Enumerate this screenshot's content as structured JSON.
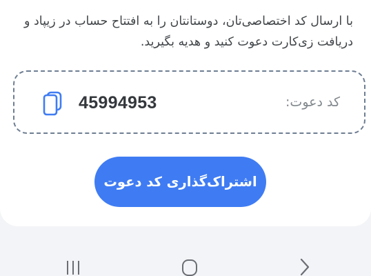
{
  "invite": {
    "description": "با ارسال کد اختصاصی‌تان، دوستانتان را به افتتاح حساب در زیپاد و دریافت زی‌کارت دعوت کنید و هدیه بگیرید.",
    "code_label": "کد دعوت:",
    "code_value": "45994953",
    "copy_icon": "copy-icon",
    "share_button_label": "اشتراک‌گذاری کد دعوت"
  },
  "nav_bar": {
    "recents_icon": "recent-apps-icon",
    "home_icon": "home-icon",
    "back_icon": "back-icon"
  },
  "colors": {
    "accent": "#3f7cf3",
    "background": "#f3f4f7",
    "card": "#ffffff",
    "dashed_border": "#6d7d92"
  }
}
